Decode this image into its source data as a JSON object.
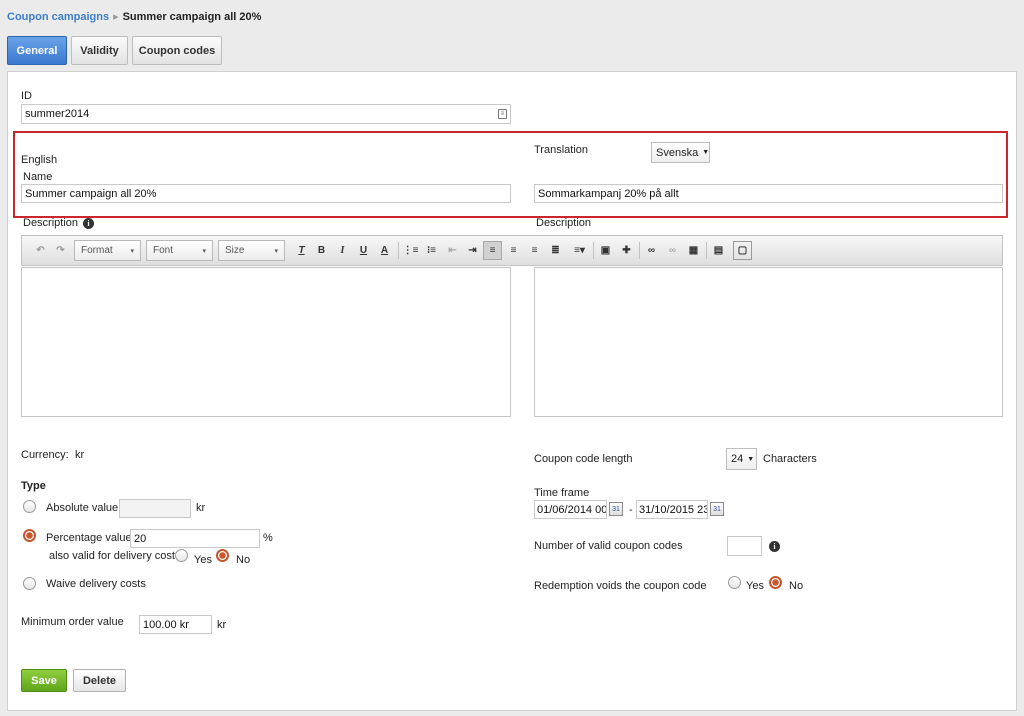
{
  "breadcrumb": {
    "parent": "Coupon campaigns",
    "separator": "▸",
    "current": "Summer campaign all 20%"
  },
  "tabs": [
    {
      "label": "General",
      "active": true
    },
    {
      "label": "Validity",
      "active": false
    },
    {
      "label": "Coupon codes",
      "active": false
    }
  ],
  "id_field": {
    "label": "ID",
    "value": "summer2014"
  },
  "translation": {
    "language_label": "English",
    "label": "Translation",
    "selected": "Svenska",
    "name_label": "Name",
    "name_value": "Summer campaign all 20%",
    "name_translated": "Sommarkampanj 20% på allt"
  },
  "description": {
    "label": "Description",
    "label_right": "Description"
  },
  "toolbar": {
    "format": "Format",
    "font": "Font",
    "size": "Size"
  },
  "currency": {
    "label": "Currency:",
    "value": "kr"
  },
  "type": {
    "heading": "Type",
    "absolute_label": "Absolute value",
    "absolute_value": "",
    "absolute_unit": "kr",
    "percentage_label": "Percentage value",
    "percentage_value": "20",
    "percentage_unit": "%",
    "delivery_label": "also valid for delivery costs",
    "yes": "Yes",
    "no": "No",
    "waive_label": "Waive delivery costs"
  },
  "minimum_order": {
    "label": "Minimum order value",
    "value": "100.00 kr",
    "unit": "kr"
  },
  "coupon": {
    "length_label": "Coupon code length",
    "length_value": "24",
    "length_unit": "Characters",
    "timeframe_label": "Time frame",
    "start": "01/06/2014 00:",
    "dash": "-",
    "end": "31/10/2015 23",
    "valid_codes_label": "Number of valid coupon codes",
    "valid_codes_value": "",
    "redemption_label": "Redemption voids the coupon code",
    "yes": "Yes",
    "no": "No"
  },
  "buttons": {
    "save": "Save",
    "delete": "Delete"
  }
}
